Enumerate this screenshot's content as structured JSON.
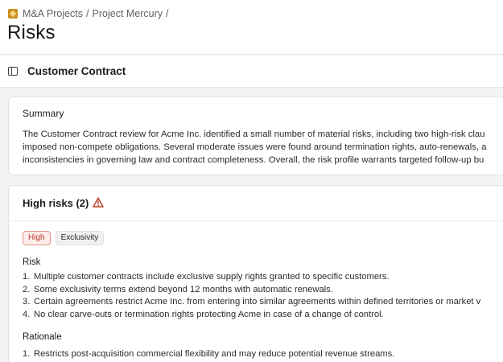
{
  "breadcrumb": {
    "items": [
      "M&A Projects",
      "Project Mercury"
    ],
    "separator": "/"
  },
  "page": {
    "title": "Risks"
  },
  "section": {
    "title": "Customer Contract"
  },
  "summary": {
    "label": "Summary",
    "lines": [
      "The Customer Contract review for Acme Inc. identified a small number of material risks, including two high-risk clau",
      "imposed non-compete obligations. Several moderate issues were found around termination rights, auto-renewals, a",
      "inconsistencies in governing law and contract completeness. Overall, the risk profile warrants targeted follow-up bu"
    ]
  },
  "high_risks": {
    "title": "High risks (2)",
    "badges": {
      "severity": "High",
      "category": "Exclusivity"
    },
    "risk_label": "Risk",
    "risk_items": [
      {
        "num": "1.",
        "text": "Multiple customer contracts include exclusive supply rights granted to specific customers."
      },
      {
        "num": "2.",
        "text": "Some exclusivity terms extend beyond 12 months with automatic renewals."
      },
      {
        "num": "3.",
        "text": "Certain agreements restrict Acme Inc. from entering into similar agreements within defined territories or market v"
      },
      {
        "num": "4.",
        "text": "No clear carve-outs or termination rights protecting Acme in case of a change of control."
      }
    ],
    "rationale_label": "Rationale",
    "rationale_items": [
      {
        "num": "1.",
        "text": "Restricts post-acquisition commercial flexibility and may reduce potential revenue streams."
      }
    ]
  },
  "colors": {
    "accent_warning": "#c0392b",
    "logo": "#c8901e",
    "background": "#f4f4f5"
  },
  "icons": {
    "logo": "project-logo-icon",
    "sidebar": "sidebar-toggle-icon",
    "warning": "warning-triangle-icon"
  }
}
